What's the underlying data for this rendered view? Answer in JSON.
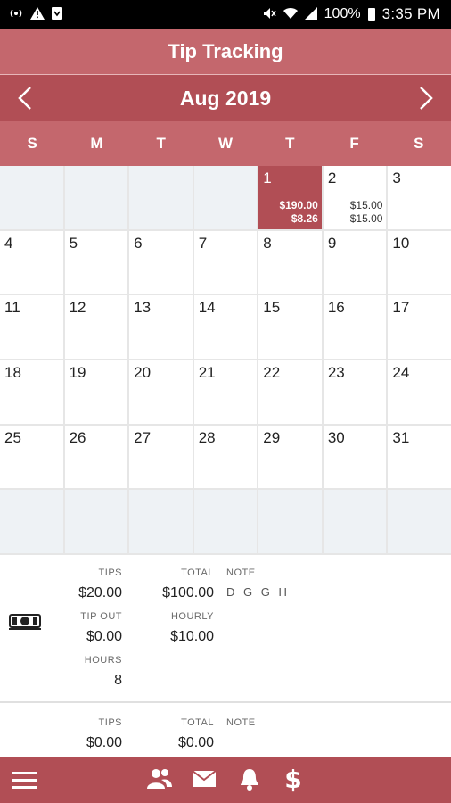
{
  "status_bar": {
    "time": "3:35 PM",
    "battery": "100%",
    "left_icons": [
      "hotspot-icon",
      "warning-icon",
      "download-icon"
    ],
    "right_icons": [
      "mute-icon",
      "wifi-icon",
      "signal-icon",
      "battery-icon"
    ]
  },
  "app": {
    "title": "Tip Tracking"
  },
  "calendar": {
    "month_label": "Aug 2019",
    "weekdays": [
      "S",
      "M",
      "T",
      "W",
      "T",
      "F",
      "S"
    ],
    "selected_day": "1",
    "days": [
      {
        "day": ""
      },
      {
        "day": ""
      },
      {
        "day": ""
      },
      {
        "day": ""
      },
      {
        "day": "1",
        "amount_1": "$190.00",
        "amount_2": "$8.26"
      },
      {
        "day": "2",
        "amount_1": "$15.00",
        "amount_2": "$15.00"
      },
      {
        "day": "3"
      },
      {
        "day": "4"
      },
      {
        "day": "5"
      },
      {
        "day": "6"
      },
      {
        "day": "7"
      },
      {
        "day": "8"
      },
      {
        "day": "9"
      },
      {
        "day": "10"
      },
      {
        "day": "11"
      },
      {
        "day": "12"
      },
      {
        "day": "13"
      },
      {
        "day": "14"
      },
      {
        "day": "15"
      },
      {
        "day": "16"
      },
      {
        "day": "17"
      },
      {
        "day": "18"
      },
      {
        "day": "19"
      },
      {
        "day": "20"
      },
      {
        "day": "21"
      },
      {
        "day": "22"
      },
      {
        "day": "23"
      },
      {
        "day": "24"
      },
      {
        "day": "25"
      },
      {
        "day": "26"
      },
      {
        "day": "27"
      },
      {
        "day": "28"
      },
      {
        "day": "29"
      },
      {
        "day": "30"
      },
      {
        "day": "31"
      },
      {
        "day": ""
      },
      {
        "day": ""
      },
      {
        "day": ""
      },
      {
        "day": ""
      },
      {
        "day": ""
      },
      {
        "day": ""
      },
      {
        "day": ""
      }
    ]
  },
  "entries": [
    {
      "icon": "cash-icon",
      "tips_label": "TIPS",
      "tips": "$20.00",
      "total_label": "TOTAL",
      "total": "$100.00",
      "note_label": "NOTE",
      "note": "D G G H",
      "tip_out_label": "TIP OUT",
      "tip_out": "$0.00",
      "hourly_label": "HOURLY",
      "hourly": "$10.00",
      "hours_label": "HOURS",
      "hours": "8"
    },
    {
      "tips_label": "TIPS",
      "tips": "$0.00",
      "total_label": "TOTAL",
      "total": "$0.00",
      "note_label": "NOTE",
      "note": ""
    }
  ],
  "bottom_nav": {
    "items": [
      "menu-icon",
      "people-icon",
      "mail-icon",
      "bell-icon",
      "dollar-icon"
    ]
  },
  "colors": {
    "header": "#c4676d",
    "header_dark": "#b14e55",
    "empty_cell": "#eef2f5"
  }
}
